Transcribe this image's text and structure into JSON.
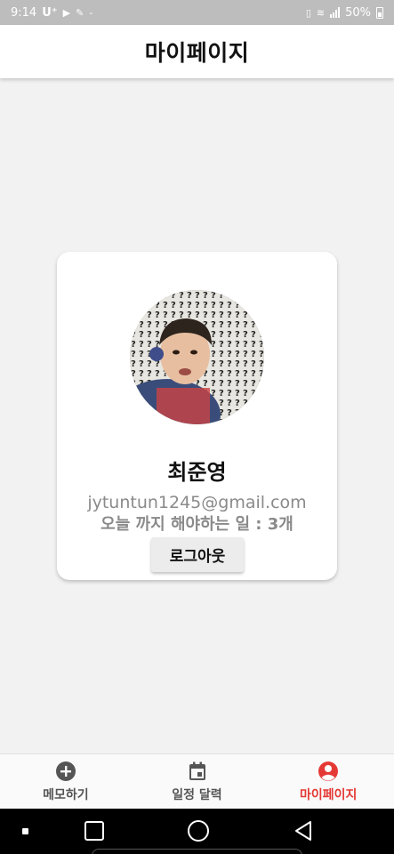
{
  "status_bar": {
    "time": "9:14",
    "carrier": "U⁺",
    "battery": "50%"
  },
  "app_bar": {
    "title": "마이페이지"
  },
  "profile": {
    "name": "최준영",
    "email": "jytuntun1245@gmail.com",
    "todo_text": "오늘 까지 해야하는 일 : 3개",
    "logout_label": "로그아웃"
  },
  "tabs": [
    {
      "label": "메모하기",
      "icon": "add-circle-icon",
      "active": false
    },
    {
      "label": "일정 달력",
      "icon": "calendar-icon",
      "active": false
    },
    {
      "label": "마이페이지",
      "icon": "account-circle-icon",
      "active": true
    }
  ],
  "colors": {
    "active_tab": "#e53935",
    "inactive_tab": "#555555",
    "status_bar": "#bdbdbd",
    "background": "#f2f2f2"
  }
}
